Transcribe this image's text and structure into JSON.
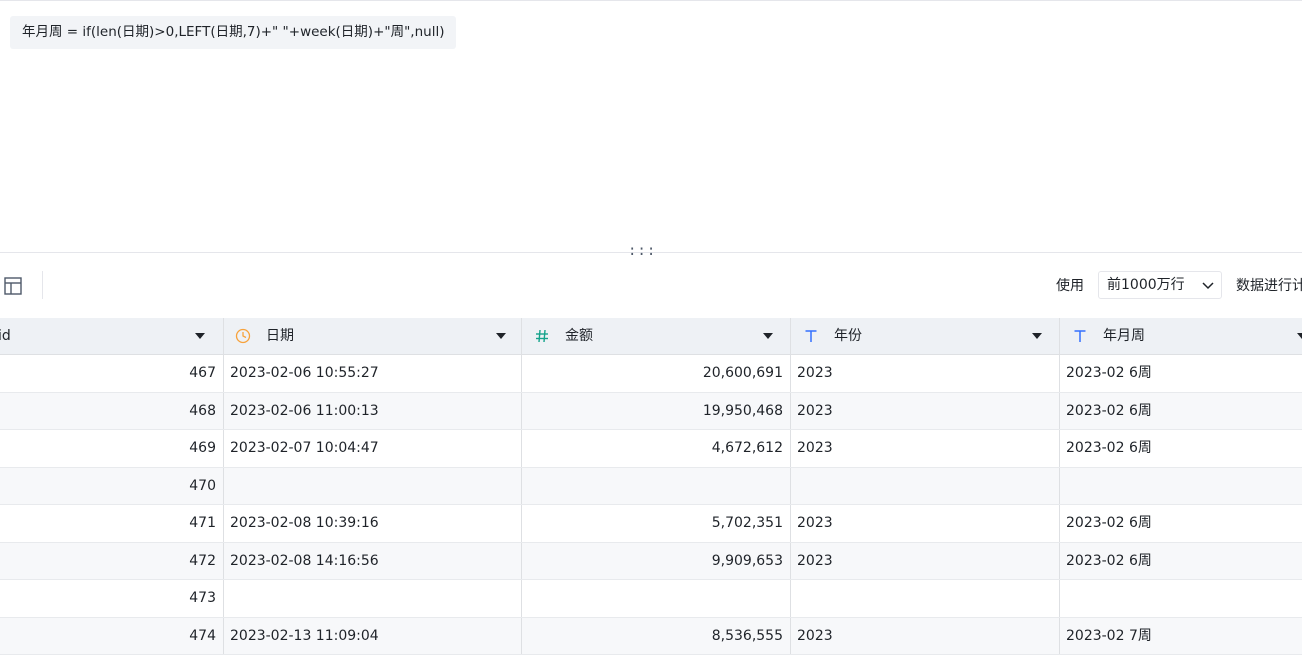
{
  "formula": {
    "text": "年月周 = if(len(日期)>0,LEFT(日期,7)+\" \"+week(日期)+\"周\",null)"
  },
  "splitter": {
    "handle": ":::"
  },
  "toolbar": {
    "use_label": "使用",
    "row_limit": {
      "selected": "前1000万行"
    },
    "trailing_text": "数据进行计"
  },
  "table": {
    "columns": [
      {
        "label": "id",
        "type": "none"
      },
      {
        "label": "日期",
        "type": "datetime",
        "icon": "clock-icon",
        "icon_color": "#f7a23b"
      },
      {
        "label": "金额",
        "type": "number",
        "icon": "hash-icon",
        "icon_color": "#14a38b"
      },
      {
        "label": "年份",
        "type": "text",
        "icon": "text-type-icon",
        "icon_color": "#3370ff"
      },
      {
        "label": "年月周",
        "type": "text",
        "icon": "text-type-icon",
        "icon_color": "#3370ff"
      }
    ],
    "rows": [
      {
        "id": "467",
        "date": "2023-02-06 10:55:27",
        "amount": "20,600,691",
        "year": "2023",
        "week": "2023-02 6周"
      },
      {
        "id": "468",
        "date": "2023-02-06 11:00:13",
        "amount": "19,950,468",
        "year": "2023",
        "week": "2023-02 6周"
      },
      {
        "id": "469",
        "date": "2023-02-07 10:04:47",
        "amount": "4,672,612",
        "year": "2023",
        "week": "2023-02 6周"
      },
      {
        "id": "470",
        "date": "",
        "amount": "",
        "year": "",
        "week": ""
      },
      {
        "id": "471",
        "date": "2023-02-08 10:39:16",
        "amount": "5,702,351",
        "year": "2023",
        "week": "2023-02 6周"
      },
      {
        "id": "472",
        "date": "2023-02-08 14:16:56",
        "amount": "9,909,653",
        "year": "2023",
        "week": "2023-02 6周"
      },
      {
        "id": "473",
        "date": "",
        "amount": "",
        "year": "",
        "week": ""
      },
      {
        "id": "474",
        "date": "2023-02-13 11:09:04",
        "amount": "8,536,555",
        "year": "2023",
        "week": "2023-02 7周"
      }
    ]
  },
  "colors": {
    "header_bg": "#eef1f5",
    "alt_row_bg": "#f7f8fa",
    "border": "#dee0e3"
  }
}
